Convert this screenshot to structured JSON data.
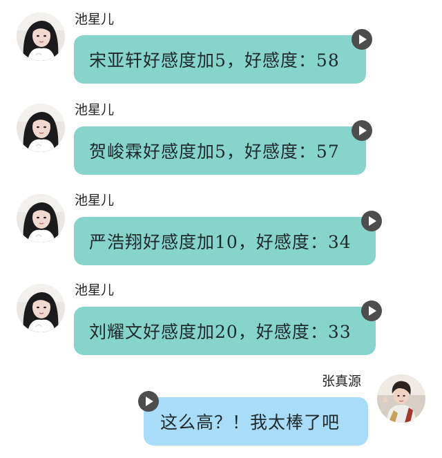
{
  "messages": [
    {
      "sender": "池星儿",
      "text": "宋亚轩好感度加5，好感度：58",
      "avatar_icon": "female-avatar-icon",
      "side": "left"
    },
    {
      "sender": "池星儿",
      "text": "贺峻霖好感度加5，好感度：57",
      "avatar_icon": "female-avatar-icon",
      "side": "left"
    },
    {
      "sender": "池星儿",
      "text": "严浩翔好感度加10，好感度：34",
      "avatar_icon": "female-avatar-icon",
      "side": "left"
    },
    {
      "sender": "池星儿",
      "text": "刘耀文好感度加20，好感度：33",
      "avatar_icon": "female-avatar-icon",
      "side": "left"
    },
    {
      "sender": "张真源",
      "text": "这么高？！我太棒了吧",
      "avatar_icon": "male-avatar-icon",
      "side": "right"
    }
  ],
  "colors": {
    "incoming_bubble": "#86d4cc",
    "outgoing_bubble": "#a8dcf8",
    "voice_button": "#4d4d4d",
    "text": "#1e2a2a"
  },
  "icons": {
    "voice": "play-icon"
  }
}
